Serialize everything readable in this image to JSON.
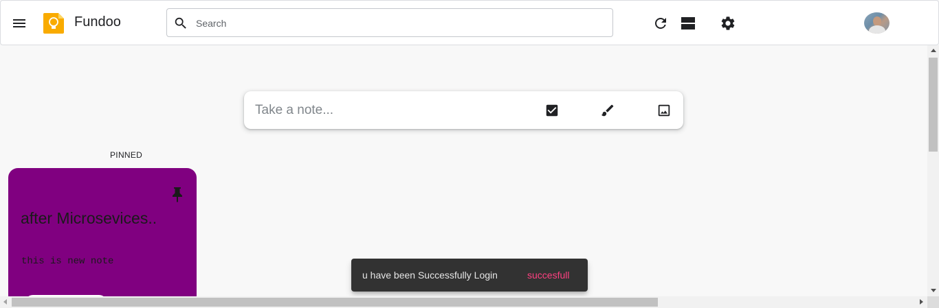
{
  "header": {
    "app_name": "Fundoo",
    "search_placeholder": "Search",
    "icons": [
      "menu-icon",
      "keep-logo-icon",
      "search-icon",
      "refresh-icon",
      "view-toggle-icon",
      "settings-icon"
    ]
  },
  "take_note": {
    "placeholder": "Take a note...",
    "icons": [
      "checkbox-icon",
      "brush-icon",
      "image-icon"
    ]
  },
  "pinned": {
    "section_label": "PINNED",
    "notes": [
      {
        "title": "after Microsevices..",
        "body": "this is new note",
        "color": "#800080"
      }
    ]
  },
  "snackbar": {
    "message": "u have been Successfully Login",
    "action": "succesfull"
  },
  "colors": {
    "logo": "#f9ab00",
    "snackbar_action": "#ff4081",
    "note_purple": "#800080"
  }
}
